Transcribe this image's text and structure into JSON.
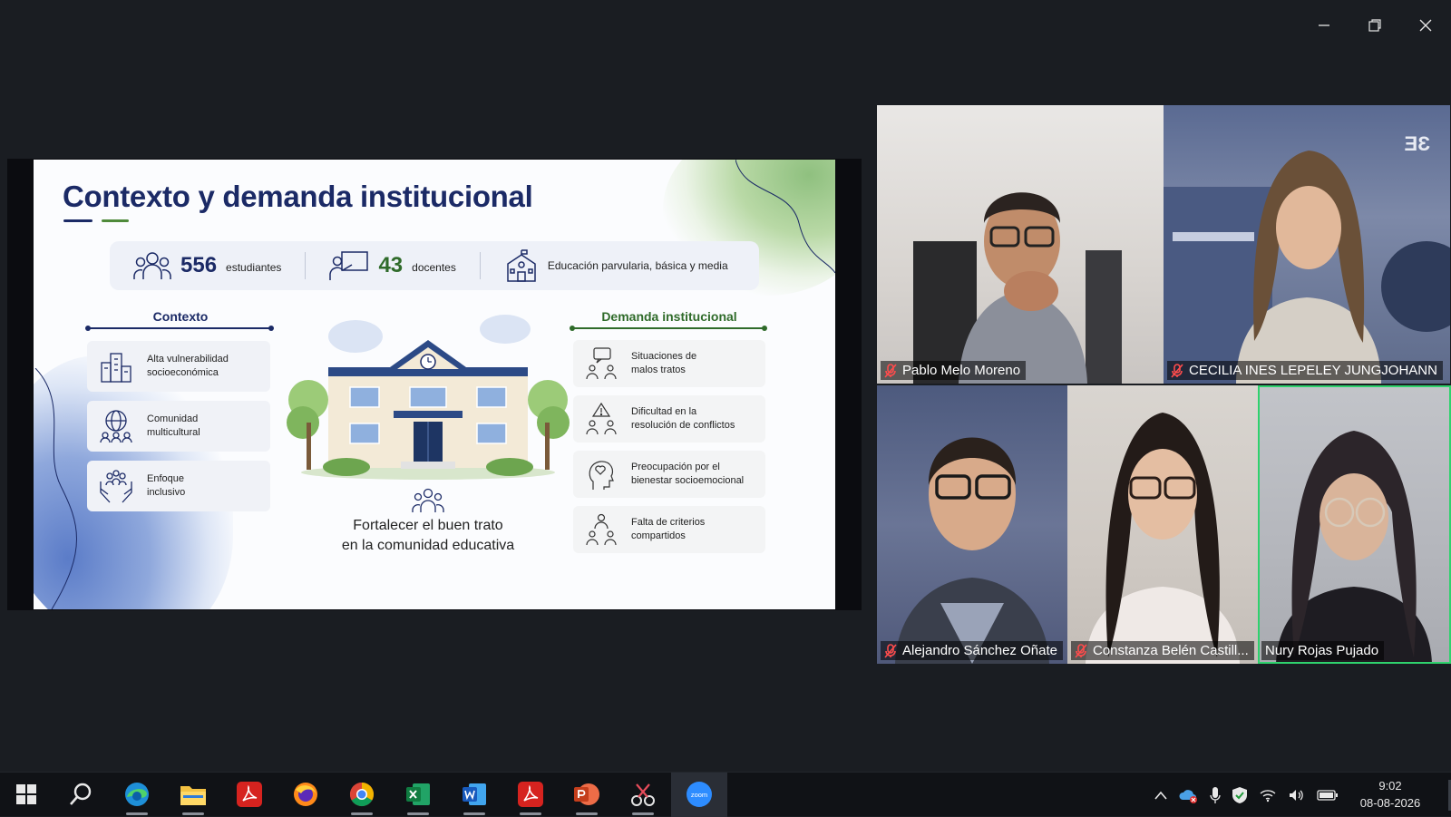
{
  "window": {
    "minimize_icon": "minimize-icon",
    "restore_icon": "restore-icon",
    "close_icon": "close-icon"
  },
  "slide": {
    "title": "Contexto y demanda institucional",
    "stats": [
      {
        "value": "556",
        "label": "estudiantes",
        "icon": "students-icon"
      },
      {
        "value": "43",
        "label": "docentes",
        "icon": "teacher-icon"
      },
      {
        "label": "Educación parvularia, básica y media",
        "icon": "school-building-icon"
      }
    ],
    "left": {
      "heading": "Contexto",
      "cards": [
        {
          "text": "Alta vulnerabilidad\nsocioeconómica",
          "icon": "city-buildings-icon"
        },
        {
          "text": "Comunidad\nmulticultural",
          "icon": "globe-people-icon"
        },
        {
          "text": "Enfoque\ninclusivo",
          "icon": "hands-people-icon"
        }
      ]
    },
    "right": {
      "heading": "Demanda institucional",
      "cards": [
        {
          "text": "Situaciones de\nmalos tratos",
          "icon": "chat-people-icon"
        },
        {
          "text": "Dificultad en la\nresolución de conflictos",
          "icon": "warning-people-icon"
        },
        {
          "text": "Preocupación por el\nbienestar socioemocional",
          "icon": "head-heart-icon"
        },
        {
          "text": "Falta de criterios\ncompartidos",
          "icon": "group-icon"
        }
      ]
    },
    "center_text": "Fortalecer el buen trato\nen la comunidad educativa",
    "colors": {
      "navy": "#1b2a66",
      "green": "#2f6b2a"
    }
  },
  "participants": [
    {
      "name": "Pablo Melo Moreno",
      "muted": true
    },
    {
      "name": "CECILIA INES LEPELEY JUNGJOHANN",
      "muted": true,
      "logo": "ƎƐ"
    },
    {
      "name": "Alejandro Sánchez Oñate",
      "muted": true
    },
    {
      "name": "Constanza Belén Castill...",
      "muted": true
    },
    {
      "name": "Nury Rojas Pujado",
      "muted": false,
      "active": true
    }
  ],
  "taskbar": {
    "apps": [
      "start-icon",
      "search-icon",
      "edge-icon",
      "file-explorer-icon",
      "acrobat-icon",
      "firefox-icon",
      "chrome-icon",
      "excel-icon",
      "word-icon",
      "acrobat-icon",
      "powerpoint-icon",
      "snipping-tool-icon",
      "zoom-icon"
    ],
    "zoom_label": "zoom",
    "clock": {
      "time": "9:02",
      "date": "08-08-2026"
    }
  }
}
